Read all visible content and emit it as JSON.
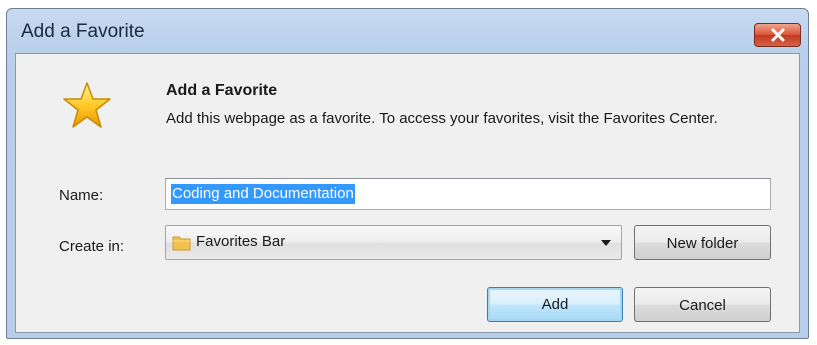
{
  "window": {
    "title": "Add a Favorite"
  },
  "dialog": {
    "heading": "Add a Favorite",
    "description": "Add this webpage as a favorite. To access your favorites, visit the Favorites Center."
  },
  "form": {
    "name_label": "Name:",
    "name_value": "Coding and Documentation",
    "create_in_label": "Create in:",
    "create_in_value": "Favorites Bar",
    "new_folder_label": "New folder"
  },
  "buttons": {
    "add_label": "Add",
    "cancel_label": "Cancel"
  },
  "icons": {
    "dialog_icon": "star-icon",
    "folder_icon": "folder-icon",
    "close_icon": "close-icon",
    "dropdown_icon": "chevron-down-icon"
  },
  "colors": {
    "selection": "#3399ff",
    "close_button": "#c2391d",
    "star": "#f5b800",
    "folder": "#f2c24f"
  }
}
